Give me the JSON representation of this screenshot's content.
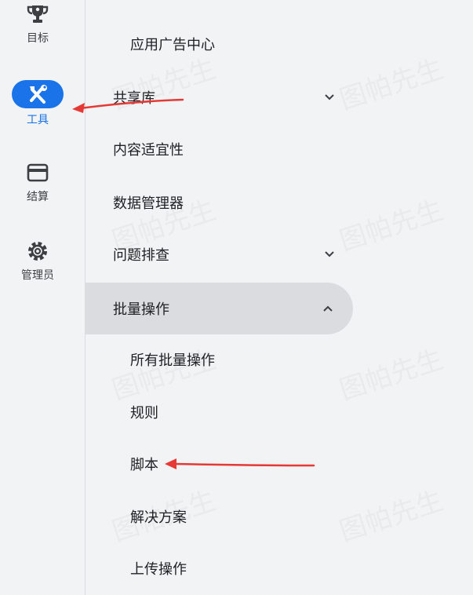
{
  "rail": {
    "items": [
      {
        "label": "目标",
        "icon": "trophy-icon",
        "active": false
      },
      {
        "label": "工具",
        "icon": "tools-icon",
        "active": true
      },
      {
        "label": "结算",
        "icon": "credit-card-icon",
        "active": false
      },
      {
        "label": "管理员",
        "icon": "gear-icon",
        "active": false
      }
    ]
  },
  "menu": {
    "items": [
      {
        "label": "应用广告中心",
        "level": "sub"
      },
      {
        "label": "共享库",
        "level": "top",
        "chevron": "down"
      },
      {
        "label": "内容适宜性",
        "level": "top"
      },
      {
        "label": "数据管理器",
        "level": "top"
      },
      {
        "label": "问题排查",
        "level": "top",
        "chevron": "down"
      },
      {
        "label": "批量操作",
        "level": "top",
        "chevron": "up",
        "expanded": true
      },
      {
        "label": "所有批量操作",
        "level": "sub"
      },
      {
        "label": "规则",
        "level": "sub"
      },
      {
        "label": "脚本",
        "level": "sub"
      },
      {
        "label": "解决方案",
        "level": "sub"
      },
      {
        "label": "上传操作",
        "level": "sub"
      }
    ]
  },
  "watermark": "图帕先生",
  "colors": {
    "accent": "#1a73e8",
    "arrow": "#e53935",
    "background": "#f1f3f4",
    "expanded_bg": "#dadce0"
  }
}
